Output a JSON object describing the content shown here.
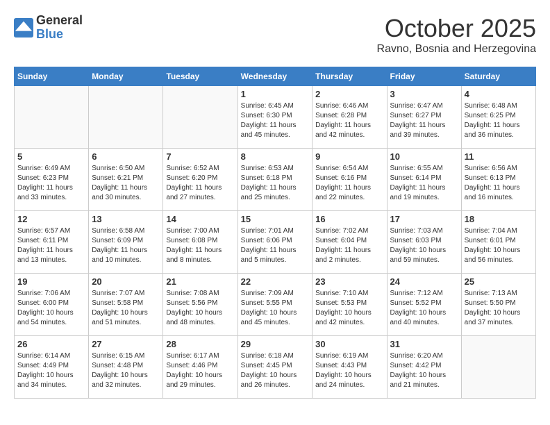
{
  "header": {
    "logo": {
      "general": "General",
      "blue": "Blue"
    },
    "title": "October 2025",
    "subtitle": "Ravno, Bosnia and Herzegovina"
  },
  "weekdays": [
    "Sunday",
    "Monday",
    "Tuesday",
    "Wednesday",
    "Thursday",
    "Friday",
    "Saturday"
  ],
  "weeks": [
    [
      {
        "day": "",
        "info": ""
      },
      {
        "day": "",
        "info": ""
      },
      {
        "day": "",
        "info": ""
      },
      {
        "day": "1",
        "info": "Sunrise: 6:45 AM\nSunset: 6:30 PM\nDaylight: 11 hours and 45 minutes."
      },
      {
        "day": "2",
        "info": "Sunrise: 6:46 AM\nSunset: 6:28 PM\nDaylight: 11 hours and 42 minutes."
      },
      {
        "day": "3",
        "info": "Sunrise: 6:47 AM\nSunset: 6:27 PM\nDaylight: 11 hours and 39 minutes."
      },
      {
        "day": "4",
        "info": "Sunrise: 6:48 AM\nSunset: 6:25 PM\nDaylight: 11 hours and 36 minutes."
      }
    ],
    [
      {
        "day": "5",
        "info": "Sunrise: 6:49 AM\nSunset: 6:23 PM\nDaylight: 11 hours and 33 minutes."
      },
      {
        "day": "6",
        "info": "Sunrise: 6:50 AM\nSunset: 6:21 PM\nDaylight: 11 hours and 30 minutes."
      },
      {
        "day": "7",
        "info": "Sunrise: 6:52 AM\nSunset: 6:20 PM\nDaylight: 11 hours and 27 minutes."
      },
      {
        "day": "8",
        "info": "Sunrise: 6:53 AM\nSunset: 6:18 PM\nDaylight: 11 hours and 25 minutes."
      },
      {
        "day": "9",
        "info": "Sunrise: 6:54 AM\nSunset: 6:16 PM\nDaylight: 11 hours and 22 minutes."
      },
      {
        "day": "10",
        "info": "Sunrise: 6:55 AM\nSunset: 6:14 PM\nDaylight: 11 hours and 19 minutes."
      },
      {
        "day": "11",
        "info": "Sunrise: 6:56 AM\nSunset: 6:13 PM\nDaylight: 11 hours and 16 minutes."
      }
    ],
    [
      {
        "day": "12",
        "info": "Sunrise: 6:57 AM\nSunset: 6:11 PM\nDaylight: 11 hours and 13 minutes."
      },
      {
        "day": "13",
        "info": "Sunrise: 6:58 AM\nSunset: 6:09 PM\nDaylight: 11 hours and 10 minutes."
      },
      {
        "day": "14",
        "info": "Sunrise: 7:00 AM\nSunset: 6:08 PM\nDaylight: 11 hours and 8 minutes."
      },
      {
        "day": "15",
        "info": "Sunrise: 7:01 AM\nSunset: 6:06 PM\nDaylight: 11 hours and 5 minutes."
      },
      {
        "day": "16",
        "info": "Sunrise: 7:02 AM\nSunset: 6:04 PM\nDaylight: 11 hours and 2 minutes."
      },
      {
        "day": "17",
        "info": "Sunrise: 7:03 AM\nSunset: 6:03 PM\nDaylight: 10 hours and 59 minutes."
      },
      {
        "day": "18",
        "info": "Sunrise: 7:04 AM\nSunset: 6:01 PM\nDaylight: 10 hours and 56 minutes."
      }
    ],
    [
      {
        "day": "19",
        "info": "Sunrise: 7:06 AM\nSunset: 6:00 PM\nDaylight: 10 hours and 54 minutes."
      },
      {
        "day": "20",
        "info": "Sunrise: 7:07 AM\nSunset: 5:58 PM\nDaylight: 10 hours and 51 minutes."
      },
      {
        "day": "21",
        "info": "Sunrise: 7:08 AM\nSunset: 5:56 PM\nDaylight: 10 hours and 48 minutes."
      },
      {
        "day": "22",
        "info": "Sunrise: 7:09 AM\nSunset: 5:55 PM\nDaylight: 10 hours and 45 minutes."
      },
      {
        "day": "23",
        "info": "Sunrise: 7:10 AM\nSunset: 5:53 PM\nDaylight: 10 hours and 42 minutes."
      },
      {
        "day": "24",
        "info": "Sunrise: 7:12 AM\nSunset: 5:52 PM\nDaylight: 10 hours and 40 minutes."
      },
      {
        "day": "25",
        "info": "Sunrise: 7:13 AM\nSunset: 5:50 PM\nDaylight: 10 hours and 37 minutes."
      }
    ],
    [
      {
        "day": "26",
        "info": "Sunrise: 6:14 AM\nSunset: 4:49 PM\nDaylight: 10 hours and 34 minutes."
      },
      {
        "day": "27",
        "info": "Sunrise: 6:15 AM\nSunset: 4:48 PM\nDaylight: 10 hours and 32 minutes."
      },
      {
        "day": "28",
        "info": "Sunrise: 6:17 AM\nSunset: 4:46 PM\nDaylight: 10 hours and 29 minutes."
      },
      {
        "day": "29",
        "info": "Sunrise: 6:18 AM\nSunset: 4:45 PM\nDaylight: 10 hours and 26 minutes."
      },
      {
        "day": "30",
        "info": "Sunrise: 6:19 AM\nSunset: 4:43 PM\nDaylight: 10 hours and 24 minutes."
      },
      {
        "day": "31",
        "info": "Sunrise: 6:20 AM\nSunset: 4:42 PM\nDaylight: 10 hours and 21 minutes."
      },
      {
        "day": "",
        "info": ""
      }
    ]
  ]
}
